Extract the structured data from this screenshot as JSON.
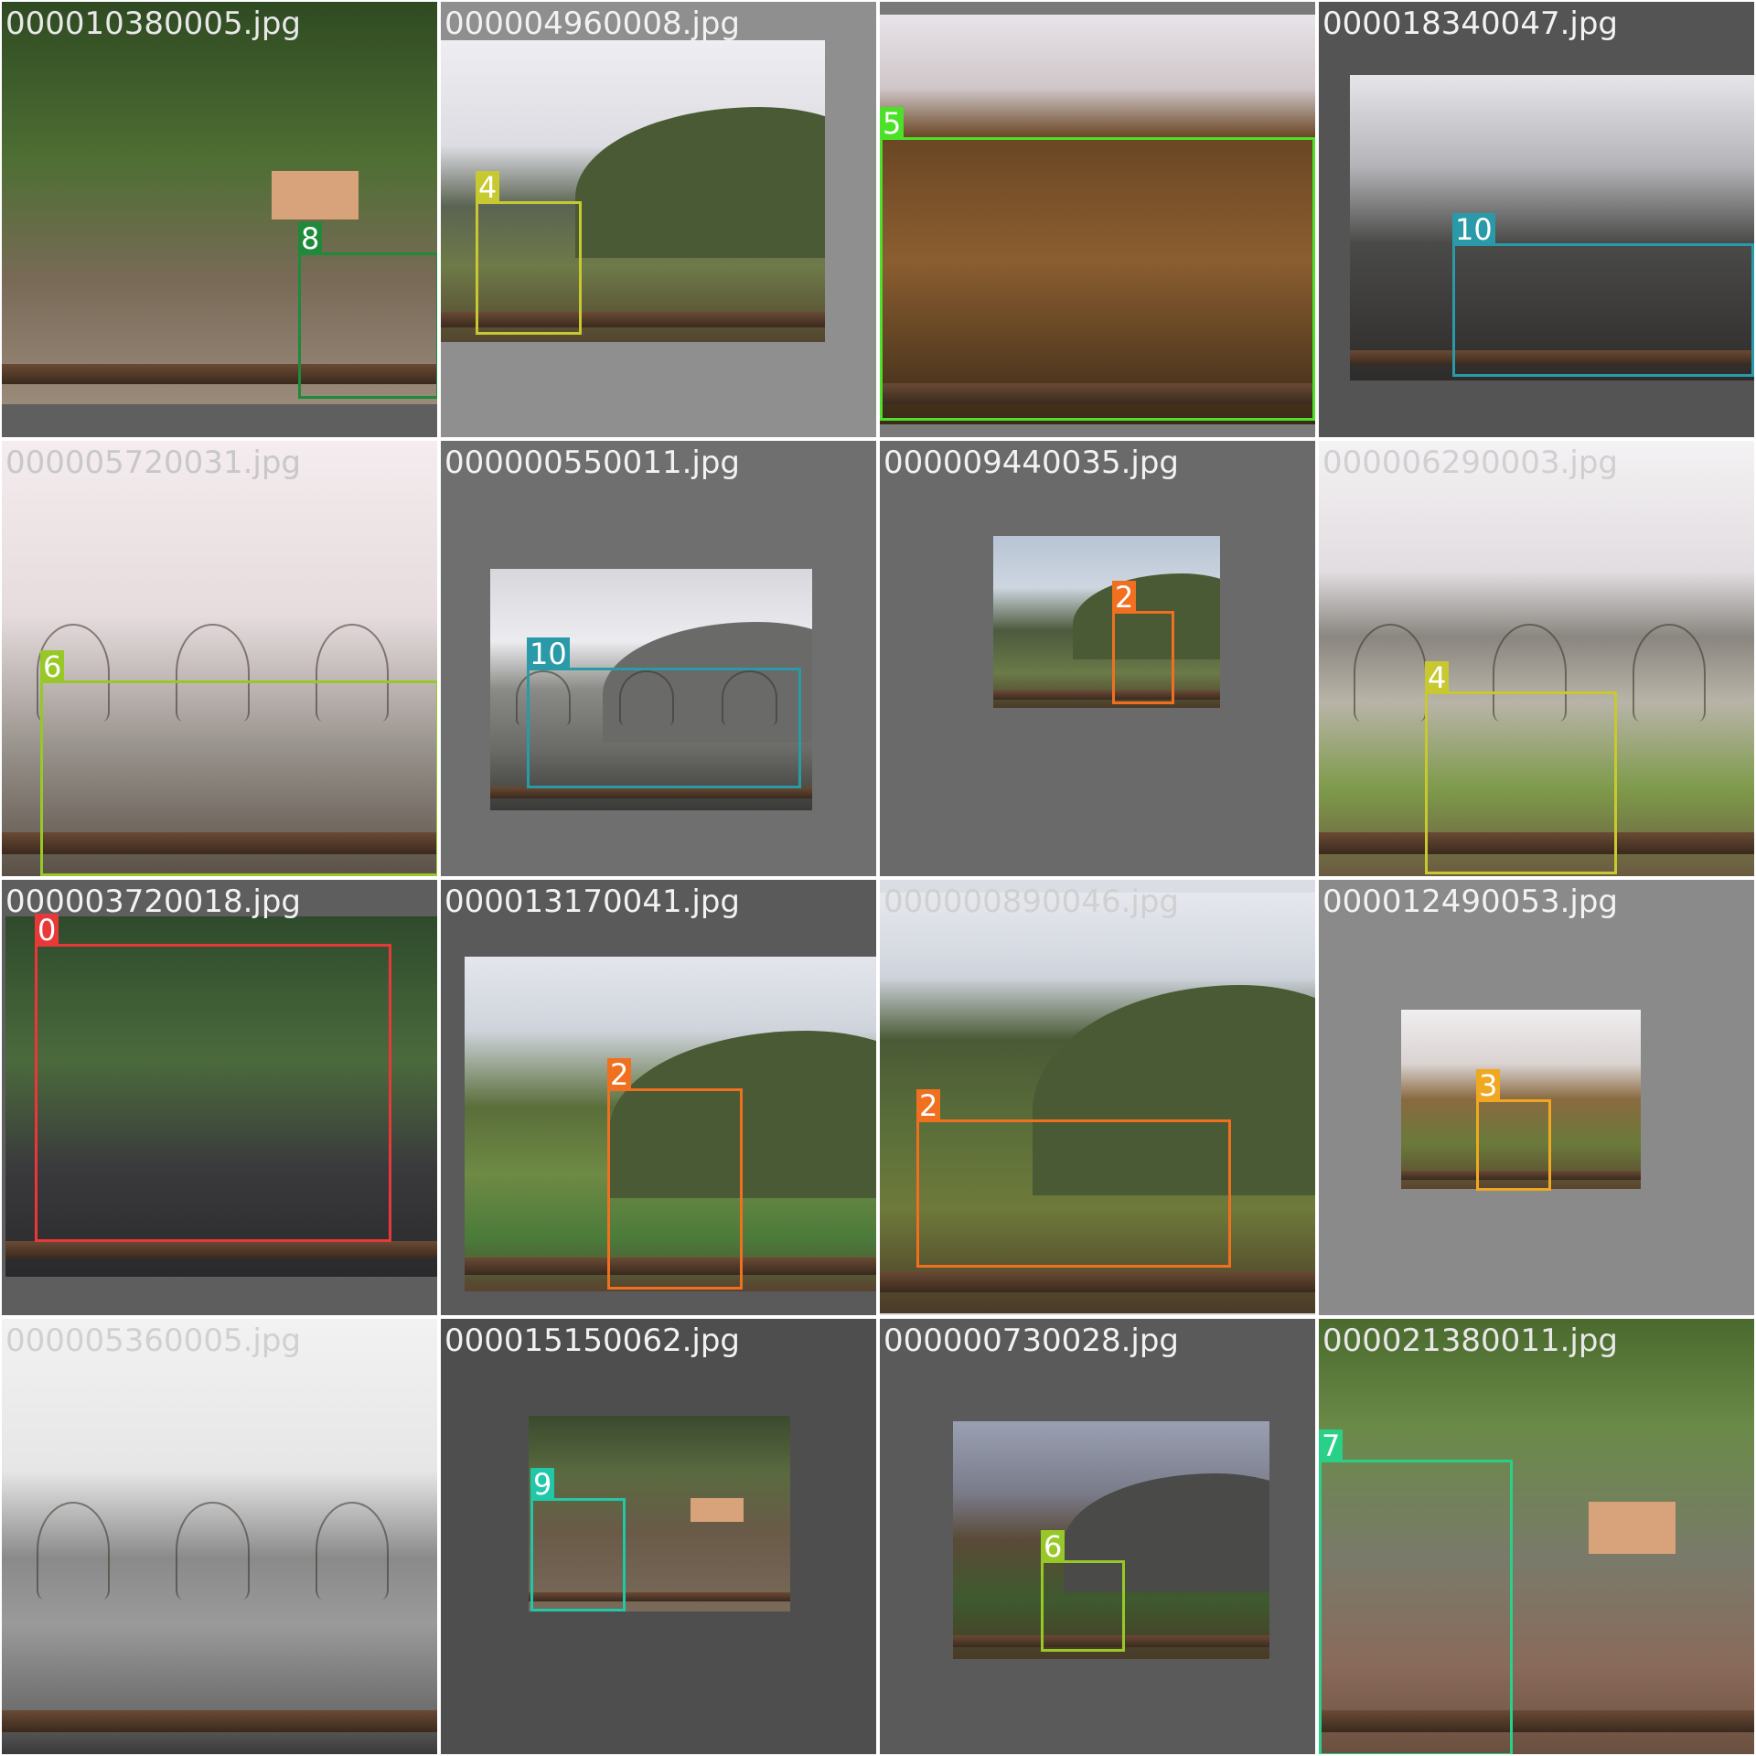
{
  "tiles": [
    {
      "filename": "000010380005.jpg",
      "background": "#5f5f5f",
      "text_color": "#e8e8e8",
      "scene": "garden",
      "detections": [
        {
          "label": "8",
          "color": "#1e8a3a"
        }
      ]
    },
    {
      "filename": "000004960008.jpg",
      "background": "#8f8f8f",
      "text_color": "#f2f2f2",
      "scene": "mountain",
      "detections": [
        {
          "label": "4",
          "color": "#c8c830"
        }
      ]
    },
    {
      "filename": "",
      "background": "#7a7a7a",
      "text_color": "#ffffff",
      "scene": "closeup-brown",
      "detections": [
        {
          "label": "5",
          "color": "#4ce028"
        }
      ]
    },
    {
      "filename": "000018340047.jpg",
      "background": "#545454",
      "text_color": "#f2f2f2",
      "scene": "dark-window",
      "detections": [
        {
          "label": "10",
          "color": "#2a9aa8"
        }
      ]
    },
    {
      "filename": "000005720031.jpg",
      "background": "#e8e0e2",
      "text_color": "#c8c8c8",
      "scene": "pale-trees",
      "detections": [
        {
          "label": "6",
          "color": "#98c828"
        }
      ]
    },
    {
      "filename": "000000550011.jpg",
      "background": "#6f6f6f",
      "text_color": "#f2f2f2",
      "scene": "mountain-grey",
      "detections": [
        {
          "label": "10",
          "color": "#2a9aa8"
        }
      ]
    },
    {
      "filename": "000009440035.jpg",
      "background": "#6a6a6a",
      "text_color": "#f2f2f2",
      "scene": "mountain-small",
      "detections": [
        {
          "label": "2",
          "color": "#f07020"
        }
      ]
    },
    {
      "filename": "000006290003.jpg",
      "background": "#e8e8ea",
      "text_color": "#d0d0d0",
      "scene": "bright-field",
      "detections": [
        {
          "label": "4",
          "color": "#c8c830"
        }
      ]
    },
    {
      "filename": "000003720018.jpg",
      "background": "#5e5e5e",
      "text_color": "#f2f2f2",
      "scene": "doves",
      "detections": [
        {
          "label": "0",
          "color": "#e83838"
        }
      ]
    },
    {
      "filename": "000013170041.jpg",
      "background": "#5a5a5a",
      "text_color": "#f2f2f2",
      "scene": "green-hill",
      "detections": [
        {
          "label": "2",
          "color": "#f07020"
        }
      ]
    },
    {
      "filename": "000000890046.jpg",
      "background": "#dadde3",
      "text_color": "#d0d0d0",
      "scene": "green-hill-wide",
      "detections": [
        {
          "label": "2",
          "color": "#f07020"
        }
      ]
    },
    {
      "filename": "000012490053.jpg",
      "background": "#8a8a8a",
      "text_color": "#f2f2f2",
      "scene": "autumn-small",
      "detections": [
        {
          "label": "3",
          "color": "#f0a820"
        }
      ]
    },
    {
      "filename": "000005360005.jpg",
      "background": "#e2e2e2",
      "text_color": "#d0d0d0",
      "scene": "grey-trees",
      "detections": []
    },
    {
      "filename": "000015150062.jpg",
      "background": "#4e4e4e",
      "text_color": "#f2f2f2",
      "scene": "garden-small",
      "detections": [
        {
          "label": "9",
          "color": "#20c8a8"
        }
      ]
    },
    {
      "filename": "000000730028.jpg",
      "background": "#5a5a5a",
      "text_color": "#f2f2f2",
      "scene": "dusk-mountain",
      "detections": [
        {
          "label": "6",
          "color": "#98c828"
        }
      ]
    },
    {
      "filename": "000021380011.jpg",
      "background": "#4a5a40",
      "text_color": "#e8e8e8",
      "scene": "garden-closeup",
      "detections": [
        {
          "label": "7",
          "color": "#28d088"
        }
      ]
    }
  ]
}
